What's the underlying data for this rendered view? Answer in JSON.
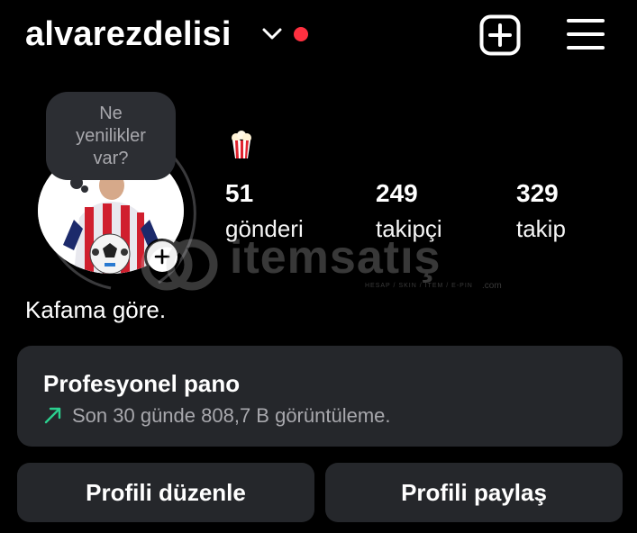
{
  "header": {
    "username": "alvarezdelisi",
    "add_icon": "plus-square-icon",
    "menu_icon": "hamburger-menu-icon",
    "live_dot_color": "#ff3040"
  },
  "note": {
    "text_line1": "Ne",
    "text_line2": "yenilikler",
    "text_line3": "var?"
  },
  "profile": {
    "emoji": "popcorn",
    "bio": "Kafama göre."
  },
  "stats": [
    {
      "value": "51",
      "label": "gönderi"
    },
    {
      "value": "249",
      "label": "takipçi"
    },
    {
      "value": "329",
      "label": "takip"
    }
  ],
  "watermark": {
    "brand": "itemsatış",
    "tagline": "HESAP / SKIN / ITEM / E-PIN",
    "suffix": ".com"
  },
  "dashboard": {
    "title": "Profesyonel pano",
    "subtitle": "Son 30 günde 808,7 B görüntüleme.",
    "trend_color": "#2bd08f"
  },
  "actions": {
    "edit_label": "Profili düzenle",
    "share_label": "Profili paylaş"
  }
}
